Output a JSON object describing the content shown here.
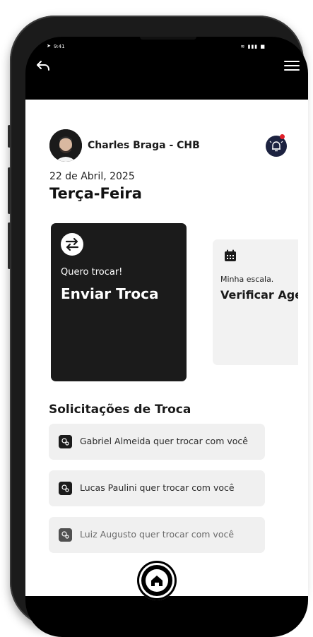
{
  "status": {
    "time": "9:41",
    "icons": "≋ ▮▮▮ ■"
  },
  "nav": {
    "back_icon": "back-arrow-icon",
    "menu_icon": "hamburger-menu-icon"
  },
  "user": {
    "name": "Charles Braga - CHB"
  },
  "date": {
    "full": "22 de Abril, 2025",
    "weekday": "Terça-Feira"
  },
  "cards": [
    {
      "subtitle": "Quero trocar!",
      "title": "Enviar Troca",
      "icon": "swap-arrows-icon"
    },
    {
      "subtitle": "Minha escala.",
      "title": "Verificar Agenda",
      "icon": "calendar-icon"
    }
  ],
  "requests": {
    "title": "Solicitações de Troca",
    "items": [
      {
        "text": "Gabriel Almeida quer trocar com você"
      },
      {
        "text": "Lucas Paulini quer trocar com você"
      },
      {
        "text": "Luiz Augusto quer trocar com você"
      }
    ]
  },
  "colors": {
    "dark": "#1b1b1b",
    "accent_notification": "#1c2240",
    "badge": "#e0202a",
    "card_light": "#f2f2f2"
  }
}
